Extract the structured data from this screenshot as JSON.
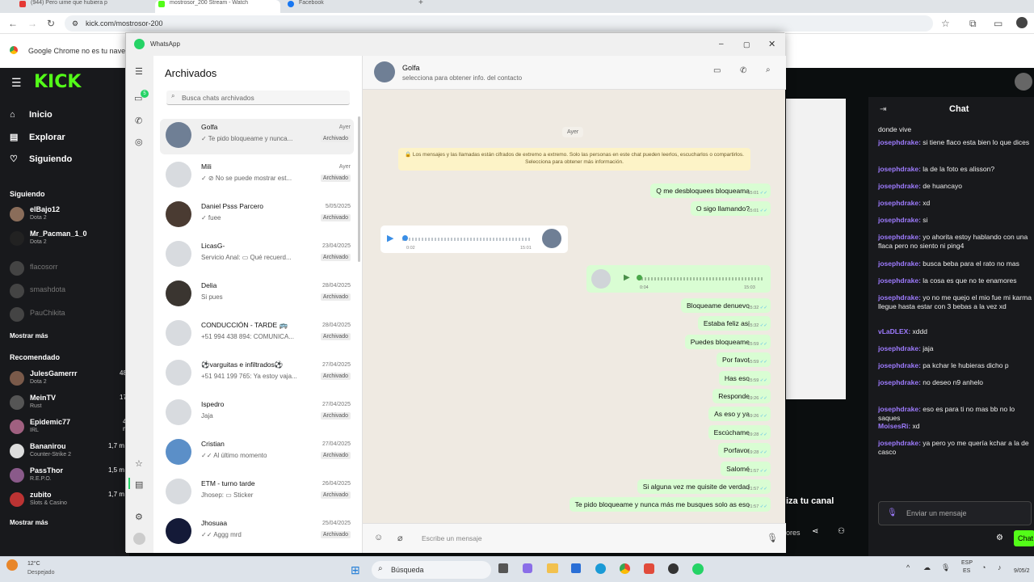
{
  "browser": {
    "tabs": [
      "(944) Pero uime que hubiera p",
      "mostrosor_200 Stream - Watch",
      "Facebook"
    ],
    "url": "kick.com/mostrosor-200",
    "infobar_text": "Google Chrome no es tu navegador"
  },
  "kick": {
    "logo": "KICK",
    "nav": [
      "Inicio",
      "Explorar",
      "Siguiendo"
    ],
    "following_heading": "Siguiendo",
    "following": [
      {
        "name": "elBajo12",
        "game": "Dota 2",
        "online": true
      },
      {
        "name": "Mr_Pacman_1_0",
        "game": "Dota 2",
        "online": true
      },
      {
        "name": "flacosorr",
        "game": "",
        "online": false
      },
      {
        "name": "smashdota",
        "game": "",
        "online": false
      },
      {
        "name": "PauChikita",
        "game": "",
        "online": false
      }
    ],
    "show_more": "Mostrar más",
    "recommended_heading": "Recomendado",
    "recommended": [
      {
        "name": "JulesGamerrr",
        "game": "Dota 2",
        "viewers": "48"
      },
      {
        "name": "MeinTV",
        "game": "Rust",
        "viewers": "17"
      },
      {
        "name": "Epidemic77",
        "game": "IRL",
        "viewers": "4 m"
      },
      {
        "name": "Bananirou",
        "game": "Counter-Strike 2",
        "viewers": "1,7 m"
      },
      {
        "name": "PassThor",
        "game": "R.E.P.O.",
        "viewers": "1,5 m"
      },
      {
        "name": "zubito",
        "game": "Slots & Casino",
        "viewers": "1,7 m"
      }
    ],
    "show_more_2": "Mostrar más",
    "chat_title": "Chat",
    "chat_messages": [
      {
        "user": "",
        "text": "donde vive"
      },
      {
        "user": "josephdrake",
        "text": "si tiene flaco esta bien lo que dices"
      },
      {
        "user": "josephdrake",
        "text": "la de la foto es alisson?"
      },
      {
        "user": "josephdrake",
        "text": "de huancayo"
      },
      {
        "user": "josephdrake",
        "text": "xd"
      },
      {
        "user": "josephdrake",
        "text": "si"
      },
      {
        "user": "josephdrake",
        "text": "yo ahorita estoy hablando con una flaca pero no siento ni ping4"
      },
      {
        "user": "josephdrake",
        "text": "busca beba para el rato no mas"
      },
      {
        "user": "josephdrake",
        "text": "la cosa es que no te enamores"
      },
      {
        "user": "josephdrake",
        "text": "yo no me quejo el mio fue mi karma llegue hasta estar con 3 bebas a la vez xd"
      },
      {
        "user": "vLaDLEX",
        "text": "xddd"
      },
      {
        "user": "josephdrake",
        "text": "jaja"
      },
      {
        "user": "josephdrake",
        "text": "pa kchar le hubieras dicho p"
      },
      {
        "user": "josephdrake",
        "text": "no deseo n9 anhelo"
      },
      {
        "user": "josephdrake",
        "text": "eso es para ti no mas bb no lo saques"
      },
      {
        "user": "MoisesRi",
        "text": "xd"
      },
      {
        "user": "josephdrake",
        "text": "ya pero yo me quería kchar a la de casco"
      }
    ],
    "chat_placeholder": "Enviar un mensaje",
    "chat_button": "Chat",
    "promo": "iza tu canal",
    "promo2": "ores"
  },
  "whatsapp": {
    "app_title": "WhatsApp",
    "panel_title": "Archivados",
    "search_placeholder": "Busca chats archivados",
    "archived_label": "Archivado",
    "chats": [
      {
        "name": "Golfa",
        "date": "Ayer",
        "preview": "✓ Te pido bloqueame y nunca...",
        "color": "#6f7f95"
      },
      {
        "name": "Mili",
        "date": "Ayer",
        "preview": "✓ ⊘ No se puede mostrar est...",
        "color": "#d8dbdf"
      },
      {
        "name": "Daniel Psss Parcero",
        "date": "5/05/2025",
        "preview": "✓ fuee",
        "color": "#4a3b32"
      },
      {
        "name": "LicasG-",
        "date": "23/04/2025",
        "preview": "Servicio Anal: ▭ Qué recuerd...",
        "color": "#d8dbdf"
      },
      {
        "name": "Delia",
        "date": "28/04/2025",
        "preview": "Si pues",
        "color": "#3a3530"
      },
      {
        "name": "CONDUCCIÓN - TARDE 🚌",
        "date": "28/04/2025",
        "preview": "+51 994 438 894: COMUNICA...",
        "color": "#d8dbdf"
      },
      {
        "name": "⚽varguitas e infiltrados⚽",
        "date": "27/04/2025",
        "preview": "+51 941 199 765: Ya estoy vaja...",
        "color": "#d8dbdf"
      },
      {
        "name": "Ispedro",
        "date": "27/04/2025",
        "preview": "Jaja",
        "color": "#d8dbdf"
      },
      {
        "name": "Cristian",
        "date": "27/04/2025",
        "preview": "✓✓ Al último momento",
        "color": "#5b8fc8"
      },
      {
        "name": "ETM - turno tarde",
        "date": "26/04/2025",
        "preview": "Jhosep: ▭ Sticker",
        "color": "#d8dbdf"
      },
      {
        "name": "Jhosuaa",
        "date": "25/04/2025",
        "preview": "✓✓ Aggg mrd",
        "color": "#141a38"
      }
    ],
    "chat_header": {
      "name": "Golfa",
      "subtitle": "selecciona para obtener info. del contacto"
    },
    "date_chip": "Ayer",
    "encryption_notice": "🔒 Los mensajes y las llamadas están cifrados de extremo a extremo. Solo las personas en este chat pueden leerlos, escucharlos o compartirlos. Selecciona para obtener más información.",
    "voice_in": {
      "start": "0:02",
      "time": "15:01"
    },
    "voice_out": {
      "start": "0:04",
      "time": "15:03"
    },
    "messages_before": [
      {
        "text": "Q me desbloquees bloqueama",
        "time": "15:01"
      },
      {
        "text": "O sigo llamando?",
        "time": "15:01"
      }
    ],
    "messages_after": [
      {
        "text": "Bloqueame denuevo",
        "time": "15:32"
      },
      {
        "text": "Estaba feliz asi",
        "time": "15:32"
      },
      {
        "text": "Puedes bloqueame",
        "time": "15:59"
      },
      {
        "text": "Por favot",
        "time": "15:59"
      },
      {
        "text": "Has eso",
        "time": "15:59"
      },
      {
        "text": "Responde",
        "time": "19:26"
      },
      {
        "text": "As eso y ya",
        "time": "19:26"
      },
      {
        "text": "Escúchame",
        "time": "19:28"
      },
      {
        "text": "Porfavor",
        "time": "19:28"
      },
      {
        "text": "Salomé",
        "time": "21:57"
      },
      {
        "text": "Si alguna vez me quisite de verdad",
        "time": "21:57"
      },
      {
        "text": "Te pido bloqueame y nunca más me busques solo as eso",
        "time": "21:57"
      }
    ],
    "composer_placeholder": "Escribe un mensaje",
    "rail_badge": "5"
  },
  "taskbar": {
    "weather_temp": "12°C",
    "weather_desc": "Despejado",
    "search": "Búsqueda",
    "lang": "ESP",
    "lang2": "ES",
    "date": "9/05/2"
  }
}
